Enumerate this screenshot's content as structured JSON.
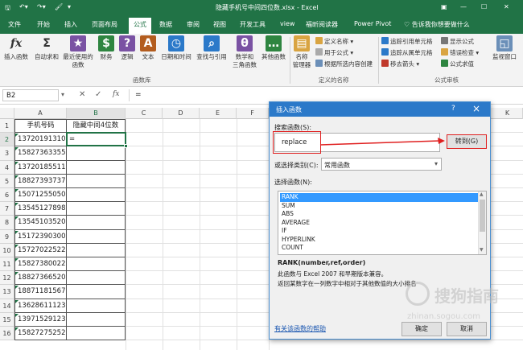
{
  "titlebar": {
    "icons": [
      "save-icon",
      "undo-icon",
      "redo-icon",
      "format-painter-icon",
      "customize-icon"
    ],
    "document_title": "隐藏手机号中间四位数.xlsx - Excel",
    "controls": [
      "ribbon-display-icon",
      "minimize-icon",
      "maximize-icon",
      "close-icon"
    ]
  },
  "tabs": [
    "文件",
    "开始",
    "插入",
    "页面布局",
    "公式",
    "数据",
    "审阅",
    "视图",
    "开发工具",
    "view",
    "福昕阅读器",
    "Power Pivot"
  ],
  "active_tab": "公式",
  "tell_me": "告诉我你想要做什么",
  "ribbon": {
    "function_library": {
      "label": "函数库",
      "buttons": [
        {
          "label": "插入函数",
          "icon": "insert-function-icon",
          "glyph": "fx",
          "color": "#333333"
        },
        {
          "label": "自动求和",
          "icon": "autosum-icon",
          "glyph": "Σ",
          "color": "#333333"
        },
        {
          "label": "最近使用的\n函数",
          "icon": "recently-used-icon",
          "glyph": "★",
          "color": "#7a52a3"
        },
        {
          "label": "财务",
          "icon": "financial-icon",
          "glyph": "$",
          "color": "#2e8540"
        },
        {
          "label": "逻辑",
          "icon": "logical-icon",
          "glyph": "?",
          "color": "#7a52a3"
        },
        {
          "label": "文本",
          "icon": "text-icon",
          "glyph": "A",
          "color": "#b35c1e"
        },
        {
          "label": "日期和时间",
          "icon": "date-time-icon",
          "glyph": "◷",
          "color": "#2b79c9"
        },
        {
          "label": "查找与引用",
          "icon": "lookup-icon",
          "glyph": "⌕",
          "color": "#2b79c9"
        },
        {
          "label": "数学和\n三角函数",
          "icon": "math-trig-icon",
          "glyph": "θ",
          "color": "#7a52a3"
        },
        {
          "label": "其他函数",
          "icon": "more-functions-icon",
          "glyph": "…",
          "color": "#2e8540"
        }
      ]
    },
    "defined_names": {
      "label": "定义的名称",
      "manager": {
        "label": "名称\n管理器",
        "icon": "name-manager-icon"
      },
      "items": [
        {
          "label": "定义名称 ▾",
          "icon": "define-name-icon"
        },
        {
          "label": "用于公式 ▾",
          "icon": "use-in-formula-icon"
        },
        {
          "label": "根据所选内容创建",
          "icon": "create-from-selection-icon"
        }
      ]
    },
    "formula_auditing": {
      "label": "公式审核",
      "items": [
        {
          "label": "追踪引用单元格",
          "icon": "trace-precedents-icon"
        },
        {
          "label": "显示公式",
          "icon": "show-formulas-icon"
        },
        {
          "label": "追踪从属单元格",
          "icon": "trace-dependents-icon"
        },
        {
          "label": "错误检查 ▾",
          "icon": "error-checking-icon"
        },
        {
          "label": "移去箭头 ▾",
          "icon": "remove-arrows-icon"
        },
        {
          "label": "公式求值",
          "icon": "evaluate-formula-icon"
        }
      ],
      "watch": {
        "label": "监视窗口",
        "icon": "watch-window-icon"
      }
    }
  },
  "formula_bar": {
    "name_box": "B2",
    "fx": "fx",
    "content": "="
  },
  "grid": {
    "columns": [
      "A",
      "B",
      "C",
      "D",
      "E",
      "F",
      "G",
      "H",
      "I",
      "J",
      "K"
    ],
    "header_row": {
      "a": "手机号码",
      "b": "隐藏中间4位数"
    },
    "rows": [
      {
        "num": "1",
        "a": "手机号码",
        "b": "隐藏中间4位数"
      },
      {
        "num": "2",
        "a": "13720191310",
        "b": "="
      },
      {
        "num": "3",
        "a": "15827363355",
        "b": ""
      },
      {
        "num": "4",
        "a": "13720185511",
        "b": ""
      },
      {
        "num": "5",
        "a": "18827393737",
        "b": ""
      },
      {
        "num": "6",
        "a": "15071255050",
        "b": ""
      },
      {
        "num": "7",
        "a": "13545127898",
        "b": ""
      },
      {
        "num": "8",
        "a": "13545103520",
        "b": ""
      },
      {
        "num": "9",
        "a": "15172390300",
        "b": ""
      },
      {
        "num": "10",
        "a": "15727022522",
        "b": ""
      },
      {
        "num": "11",
        "a": "15827380022",
        "b": ""
      },
      {
        "num": "12",
        "a": "18827366520",
        "b": ""
      },
      {
        "num": "13",
        "a": "18871181567",
        "b": ""
      },
      {
        "num": "14",
        "a": "13628611123",
        "b": ""
      },
      {
        "num": "15",
        "a": "13971529123",
        "b": ""
      },
      {
        "num": "16",
        "a": "15827275252",
        "b": ""
      }
    ]
  },
  "dialog": {
    "title": "插入函数",
    "help_button": "?",
    "close_button": "×",
    "search_label": "搜索函数(S):",
    "search_value": "replace",
    "go_button": "转到(G)",
    "category_label": "或选择类别(C):",
    "category_value": "常用函数",
    "select_label": "选择函数(N):",
    "functions": [
      "RANK",
      "SUM",
      "ABS",
      "AVERAGE",
      "IF",
      "HYPERLINK",
      "COUNT"
    ],
    "selected_function": "RANK",
    "signature": "RANK(number,ref,order)",
    "desc_line1": "此函数与 Excel 2007 和早期版本兼容。",
    "desc_line2": "返回某数字在一列数字中相对于其他数值的大小排名",
    "help_link": "有关该函数的帮助",
    "ok_button": "确定",
    "cancel_button": "取消"
  },
  "watermark": {
    "text": "搜狗指南",
    "url": "zhinan.sogou.com"
  },
  "colors": {
    "excel_green": "#217346",
    "dialog_blue": "#2b79c9",
    "selection_blue": "#3399ff",
    "annotation_red": "#e02020"
  }
}
